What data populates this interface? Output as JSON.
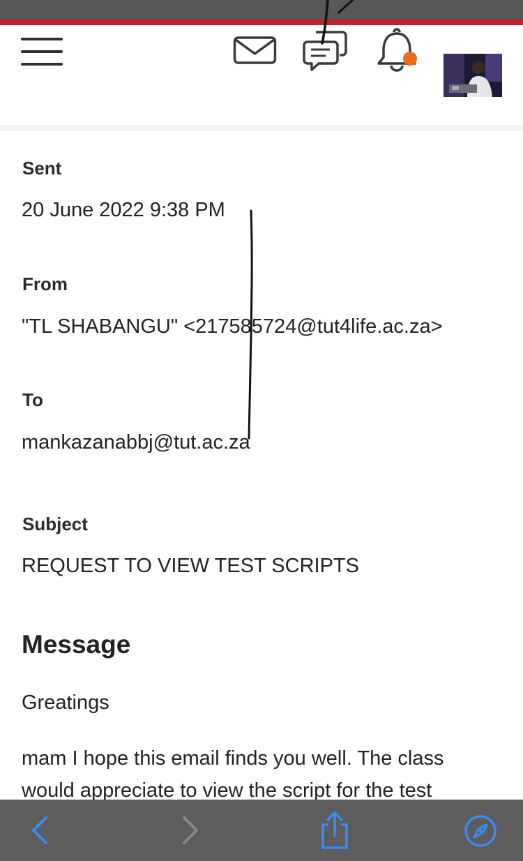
{
  "header": {
    "menu_icon": "hamburger-menu-icon",
    "mail_icon": "envelope-icon",
    "chat_icon": "chat-bubbles-icon",
    "bell_icon": "bell-icon",
    "notification_dot_color": "#ec6c1a",
    "brand_color": "#c3202b"
  },
  "email": {
    "sent_label": "Sent",
    "sent_value": "20 June 2022 9:38 PM",
    "from_label": "From",
    "from_value": "\"TL SHABANGU\" <217585724@tut4life.ac.za>",
    "to_label": "To",
    "to_value": "mankazanabbj@tut.ac.za",
    "subject_label": "Subject",
    "subject_value": "REQUEST TO VIEW TEST SCRIPTS",
    "message_title": "Message",
    "greeting": "Greatings",
    "body_line_1": "mam I hope this email finds you well. The class",
    "body_line_2": "would appreciate  to view the script for the test"
  },
  "toolbar": {
    "back_icon": "chevron-left-icon",
    "forward_icon": "chevron-right-icon",
    "share_icon": "share-icon",
    "compass_icon": "compass-icon",
    "accent_color": "#3b8df5"
  }
}
